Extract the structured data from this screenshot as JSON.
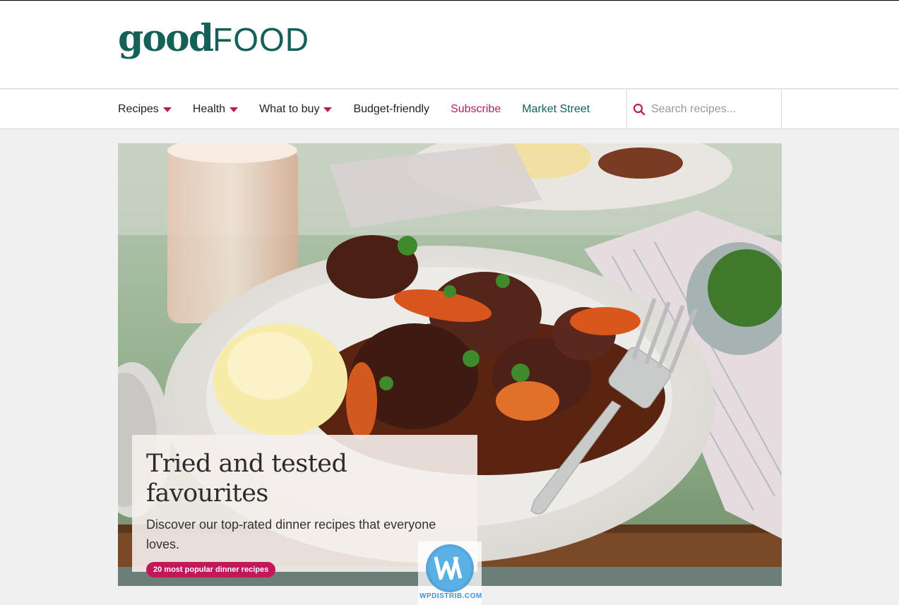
{
  "brand": {
    "part1": "good",
    "part2": "FOOD",
    "color": "#16605a"
  },
  "nav": {
    "items": [
      {
        "label": "Recipes",
        "has_dropdown": true
      },
      {
        "label": "Health",
        "has_dropdown": true
      },
      {
        "label": "What to buy",
        "has_dropdown": true
      },
      {
        "label": "Budget-friendly",
        "has_dropdown": false
      },
      {
        "label": "Subscribe",
        "has_dropdown": false
      },
      {
        "label": "Market Street",
        "has_dropdown": false
      }
    ],
    "accent_color": "#c2185b"
  },
  "search": {
    "placeholder": "Search recipes...",
    "icon": "search-icon"
  },
  "hero": {
    "title": "Tried and tested favourites",
    "description": "Discover our top-rated dinner recipes that everyone loves.",
    "cta": "20 most popular dinner recipes",
    "image": "beef-stew-plate-photo"
  },
  "watermark": {
    "text": "WPDISTRIB.COM"
  }
}
